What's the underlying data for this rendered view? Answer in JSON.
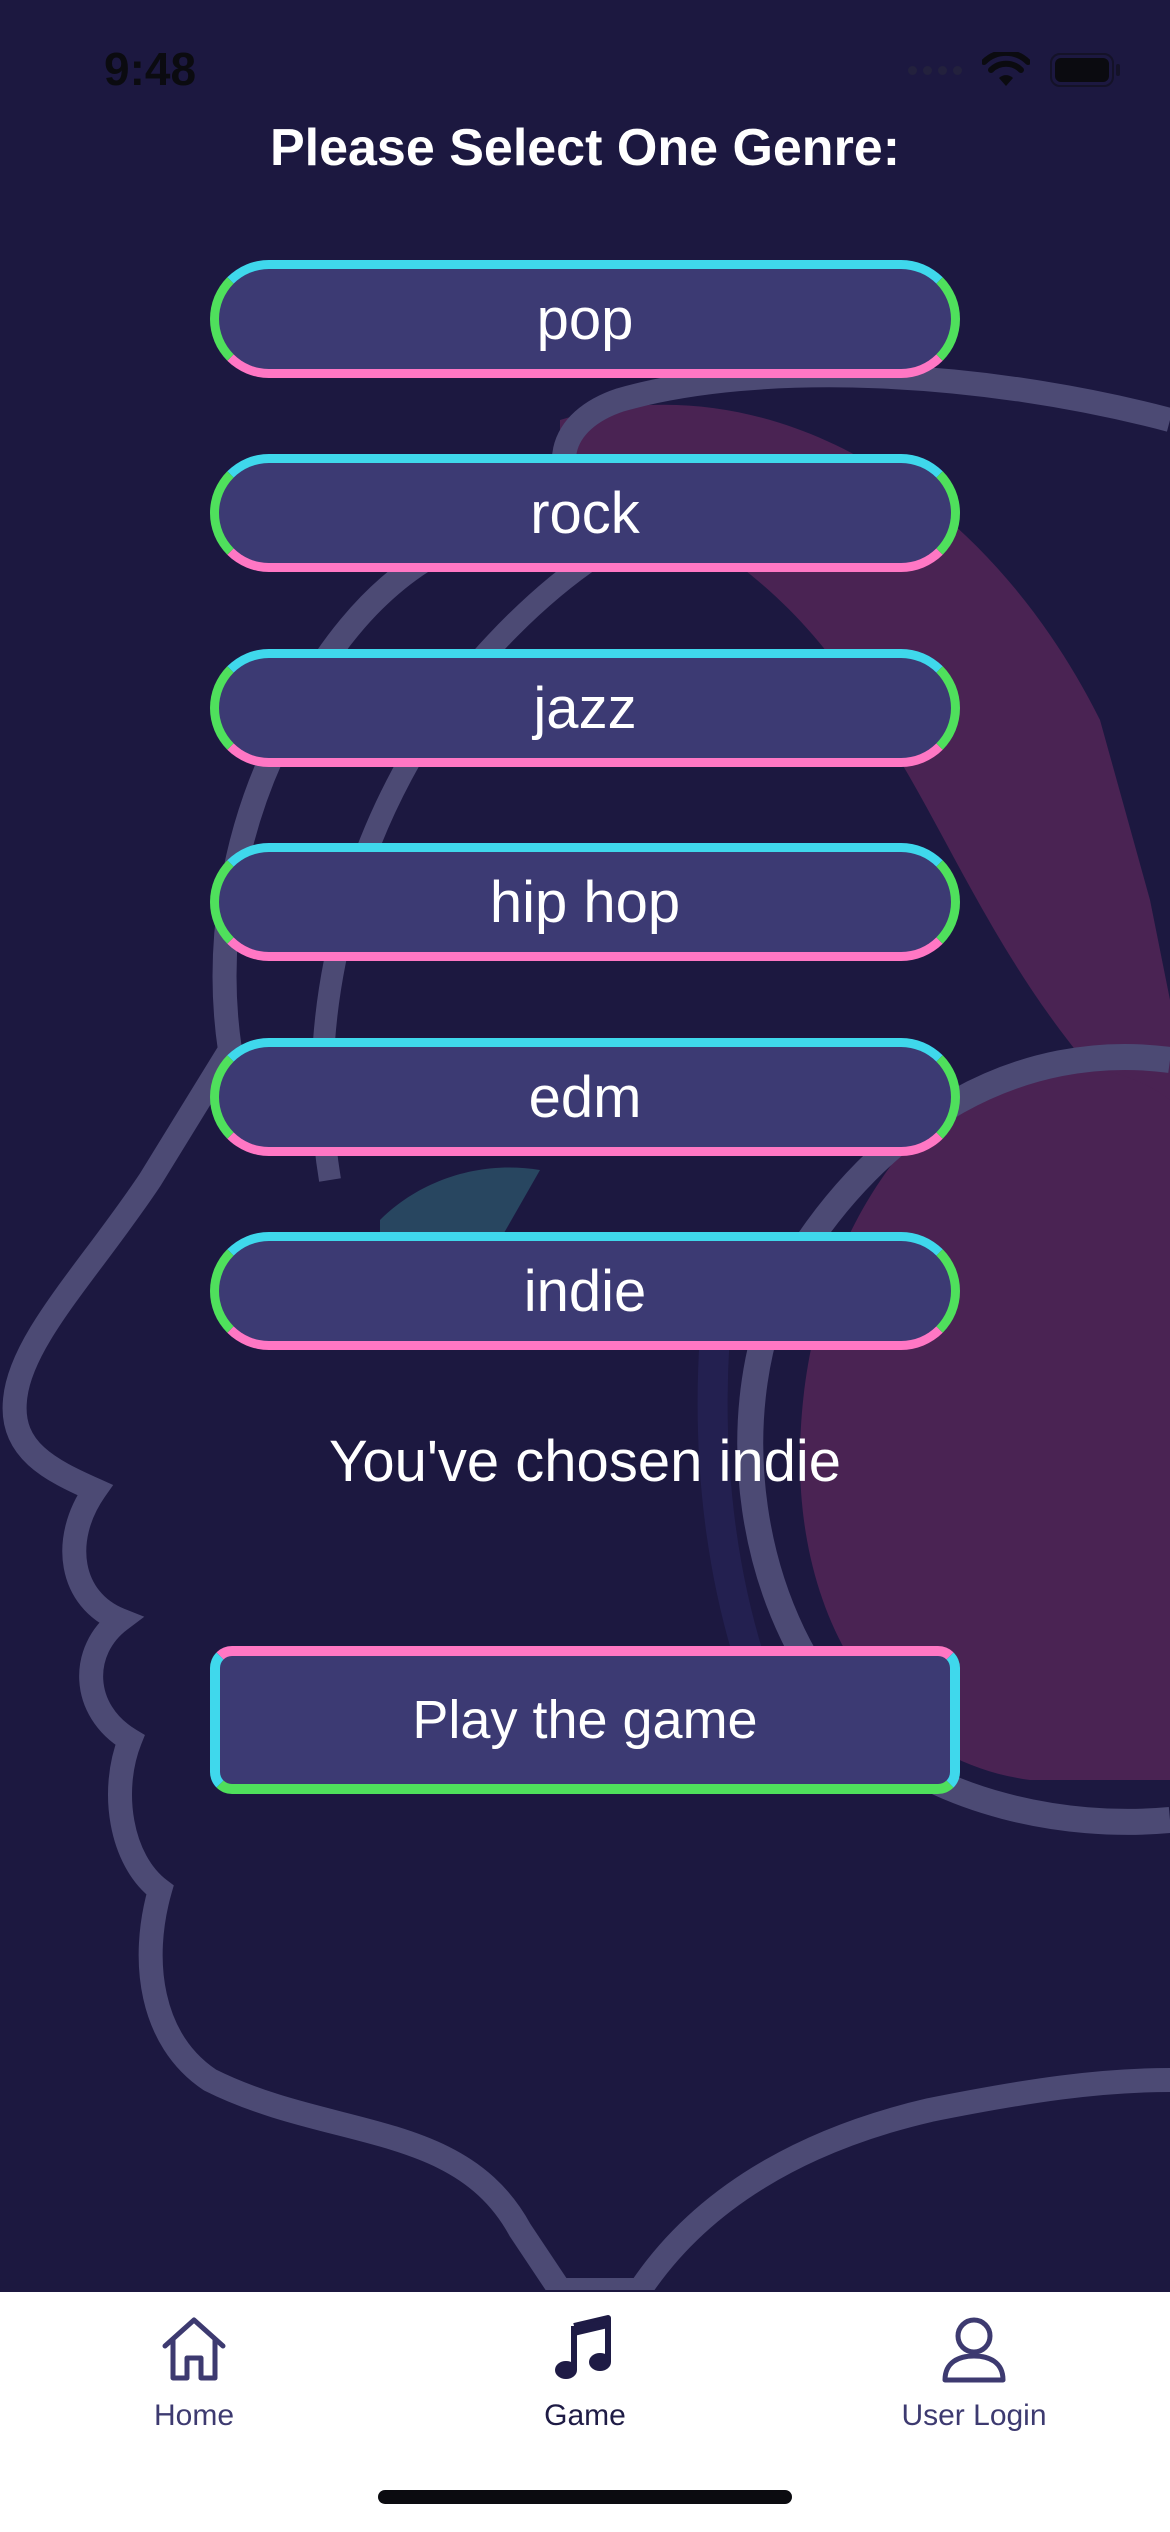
{
  "status_bar": {
    "time": "9:48"
  },
  "page": {
    "title": "Please Select One Genre:",
    "genres": [
      "pop",
      "rock",
      "jazz",
      "hip hop",
      "edm",
      "indie"
    ],
    "selection_message": "You've chosen indie",
    "play_button_label": "Play the game"
  },
  "tab_bar": {
    "items": [
      {
        "label": "Home",
        "icon": "home-icon"
      },
      {
        "label": "Game",
        "icon": "music-note-icon",
        "active": true
      },
      {
        "label": "User Login",
        "icon": "user-icon"
      }
    ]
  },
  "colors": {
    "background": "#1c1840",
    "button_fill": "#3c3a73",
    "accent_cyan": "#3fd8ec",
    "accent_green": "#4fe05c",
    "accent_pink": "#ff77c4",
    "background_art_magenta": "#4a2353",
    "tab_bar": "#ffffff"
  }
}
